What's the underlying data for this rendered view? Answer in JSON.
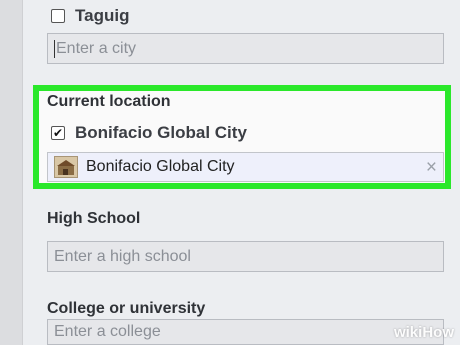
{
  "filters": {
    "taguig": {
      "label": "Taguig",
      "checked": false
    },
    "city_input": {
      "placeholder": "Enter a city"
    }
  },
  "current_location": {
    "title": "Current location",
    "option": {
      "label": "Bonifacio Global City",
      "checked": true
    },
    "selected_value": "Bonifacio Global City",
    "remove_icon": "×",
    "highlight_color": "#2ae82a"
  },
  "high_school": {
    "title": "High School",
    "input": {
      "placeholder": "Enter a high school"
    }
  },
  "college": {
    "title": "College or university",
    "input": {
      "placeholder": "Enter a college"
    }
  },
  "watermark": {
    "prefix": "wiki",
    "suffix": "How"
  }
}
